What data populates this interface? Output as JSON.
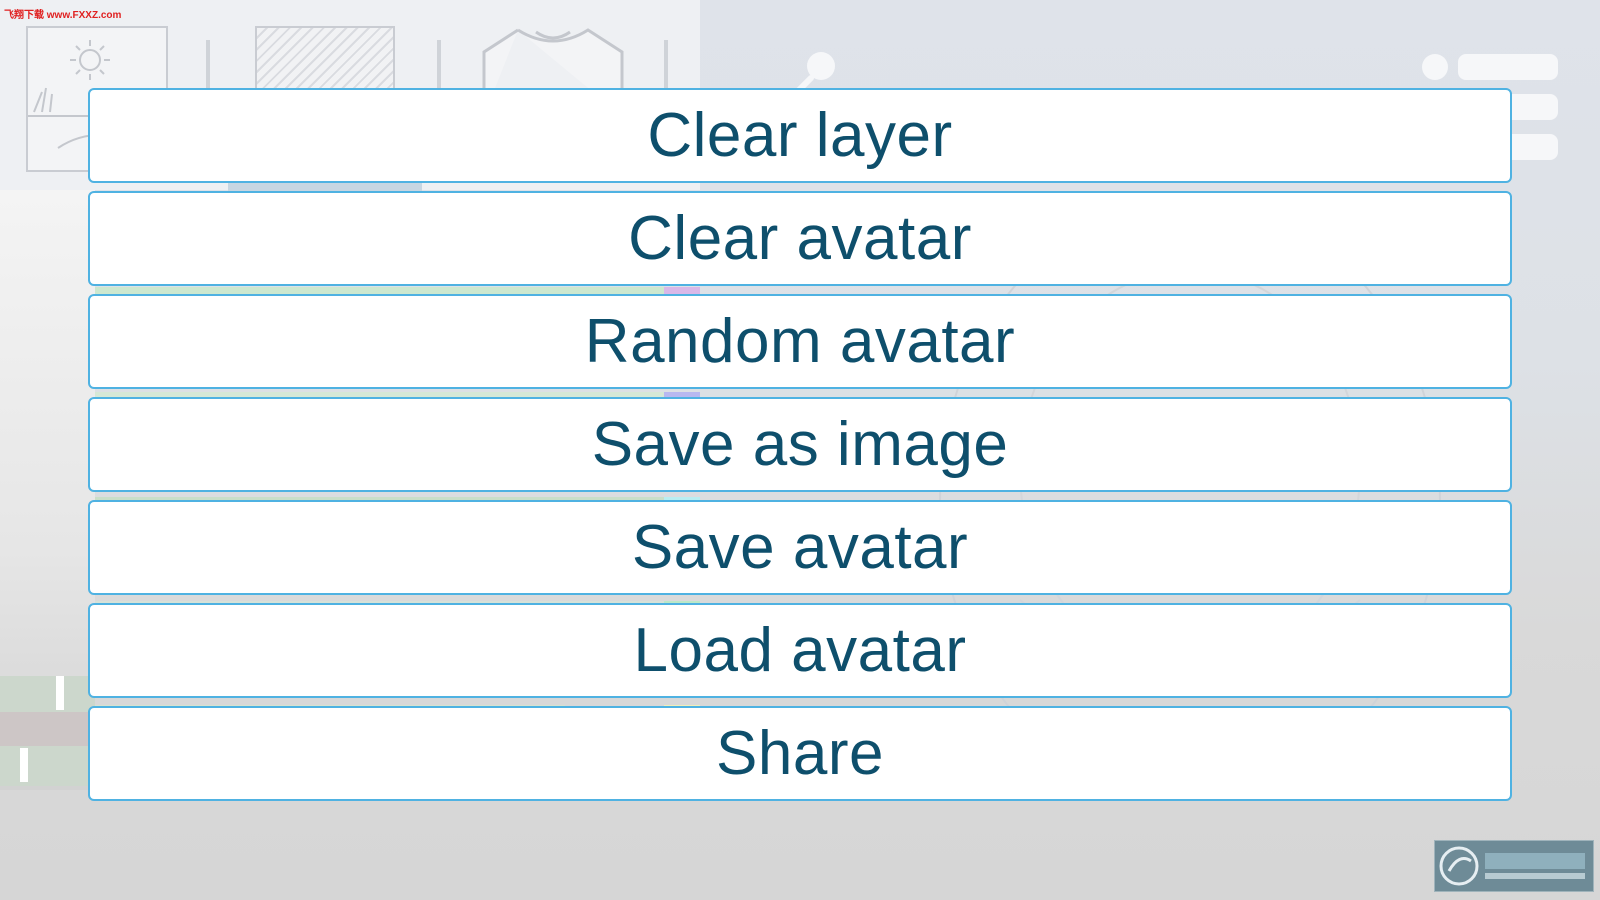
{
  "watermark": {
    "top_text": "飞翔下载 www.FXXZ.com",
    "logo_text": "飞翔下载 WWW.FXXZ.COM"
  },
  "background": {
    "tools": [
      "landscape-icon",
      "background-pattern-icon",
      "shirt-icon",
      "brush-icon",
      "menu-icon"
    ]
  },
  "menu": {
    "items": [
      {
        "label": "Clear layer"
      },
      {
        "label": "Clear avatar"
      },
      {
        "label": "Random avatar"
      },
      {
        "label": "Save as image"
      },
      {
        "label": "Save avatar"
      },
      {
        "label": "Load avatar"
      },
      {
        "label": "Share"
      }
    ]
  },
  "colors": {
    "button_border": "#4fb2e2",
    "button_text": "#0e4f6c",
    "button_bg": "#ffffff"
  }
}
